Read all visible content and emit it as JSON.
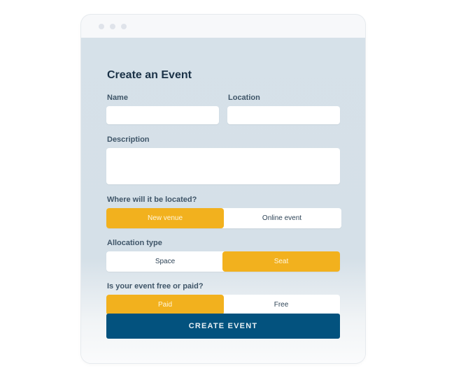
{
  "window": {
    "controls": [
      "dot",
      "dot",
      "dot"
    ]
  },
  "form": {
    "title": "Create an Event",
    "name": {
      "label": "Name",
      "value": "",
      "placeholder": ""
    },
    "location": {
      "label": "Location",
      "value": "",
      "placeholder": ""
    },
    "description": {
      "label": "Description",
      "value": "",
      "placeholder": ""
    },
    "venue": {
      "label": "Where will it be located?",
      "options": [
        "New venue",
        "Online event"
      ],
      "selected": "New venue"
    },
    "allocation": {
      "label": "Allocation type",
      "options": [
        "Space",
        "Seat"
      ],
      "selected": "Seat"
    },
    "pricing": {
      "label": "Is your event free or paid?",
      "options": [
        "Paid",
        "Free"
      ],
      "selected": "Paid"
    },
    "submit_label": "CREATE EVENT"
  },
  "colors": {
    "accent": "#f2b11e",
    "primary": "#03527e",
    "panel": "#d6e1e9"
  }
}
